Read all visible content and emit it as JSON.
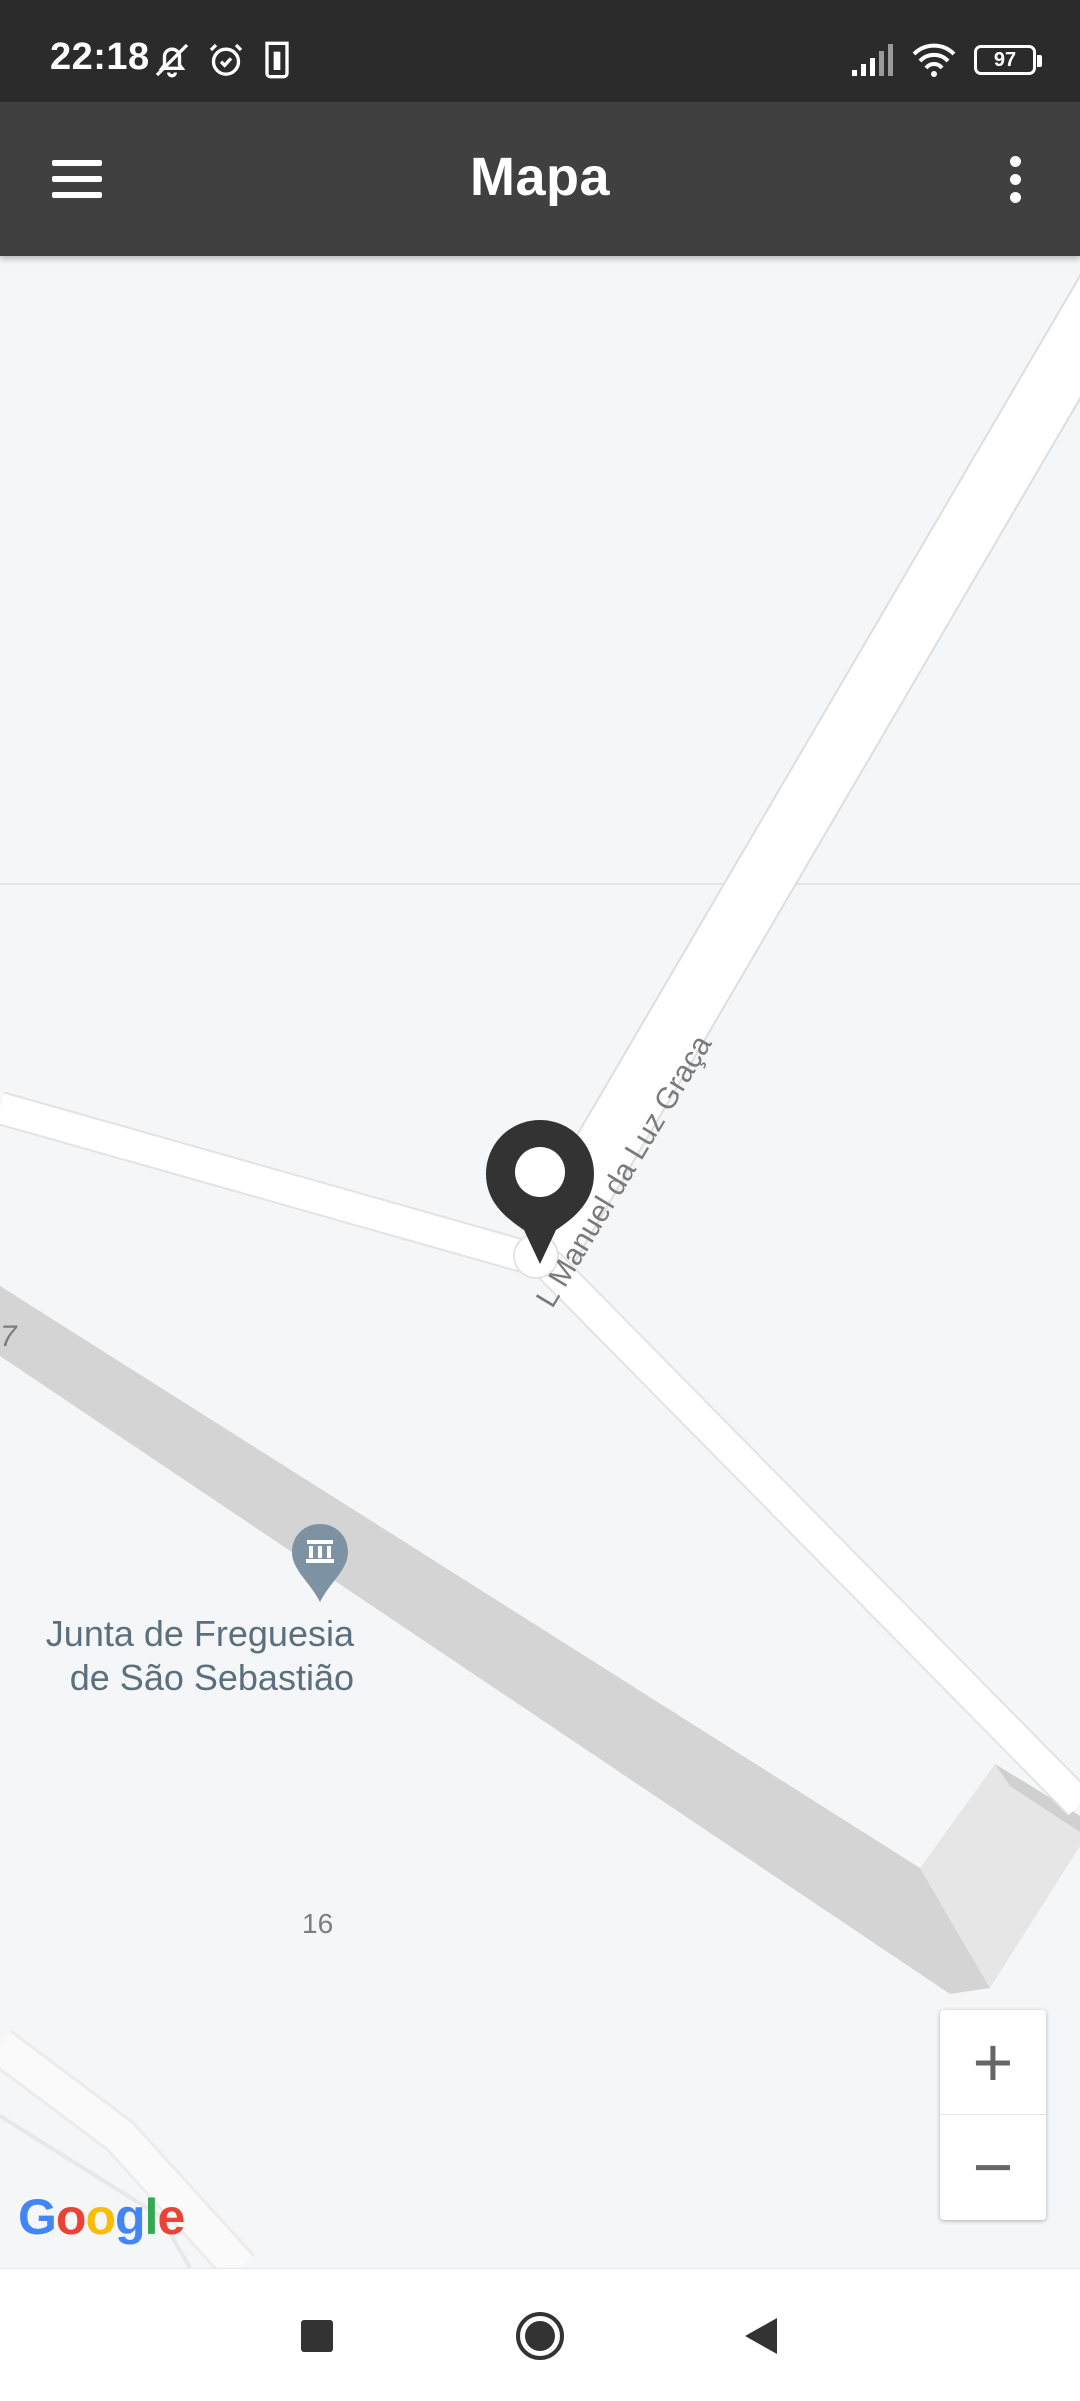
{
  "status_bar": {
    "time": "22:18",
    "left_icons": [
      "bell-off-icon",
      "alarm-icon",
      "sim-card-icon"
    ],
    "right_icons": [
      "signal-icon",
      "wifi-icon"
    ],
    "battery_level": "97"
  },
  "app_bar": {
    "title": "Mapa",
    "menu_icon": "hamburger-menu-icon",
    "overflow_icon": "more-vert-icon"
  },
  "map": {
    "street_label": "Largo Manuel da Luz Graça",
    "street_label_visible": "L  Manuel da Luz Graça",
    "poi_name_line1": "Junta de Freguesia",
    "poi_name_line2": "de São Sebastião",
    "poi_icon": "government-building-icon",
    "house_number": "16",
    "road_edge_number": "7",
    "marker_icon": "location-pin-icon",
    "attribution": "Google",
    "colors": {
      "background": "#f5f6f8",
      "road": "#ffffff",
      "major_road": "#d3d3d3",
      "marker": "#333333",
      "poi": "#7d93a3"
    }
  },
  "zoom": {
    "in_label": "+",
    "out_label": "−"
  },
  "nav_bar": {
    "recents_icon": "square-recents-icon",
    "home_icon": "circle-home-icon",
    "back_icon": "triangle-back-icon"
  }
}
